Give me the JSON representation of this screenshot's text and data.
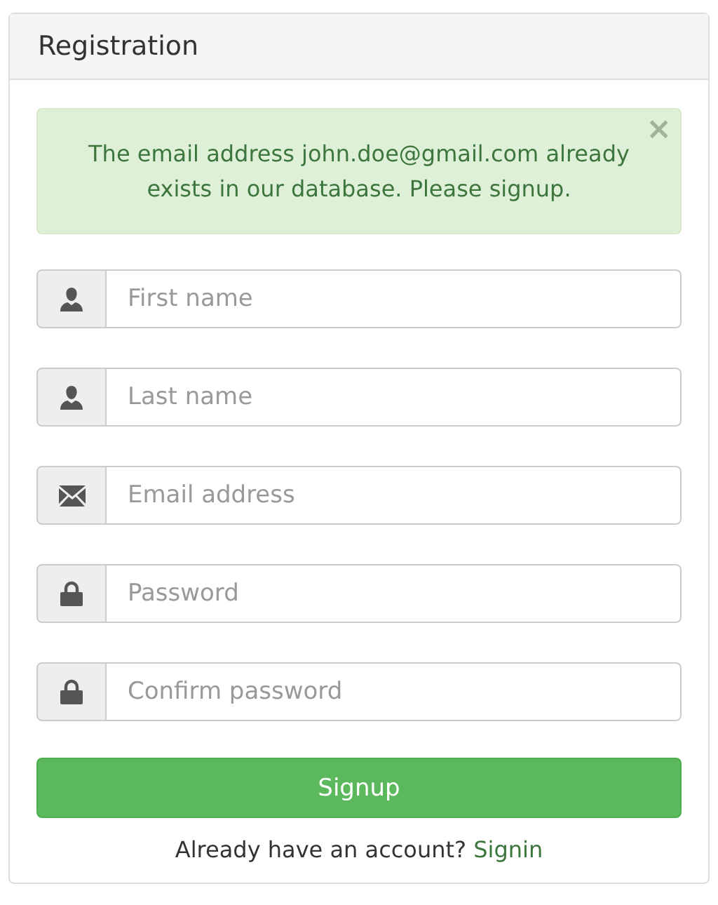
{
  "panel": {
    "title": "Registration"
  },
  "alert": {
    "message": "The email address john.doe@gmail.com already exists in our database. Please signup.",
    "close": "×"
  },
  "fields": [
    {
      "kind": "user",
      "placeholder": "First name"
    },
    {
      "kind": "user",
      "placeholder": "Last name"
    },
    {
      "kind": "email",
      "placeholder": "Email address"
    },
    {
      "kind": "lock",
      "placeholder": "Password"
    },
    {
      "kind": "lock",
      "placeholder": "Confirm password"
    }
  ],
  "submit": "Signup",
  "footer": {
    "text": "Already have an account?",
    "link": "Signin"
  }
}
